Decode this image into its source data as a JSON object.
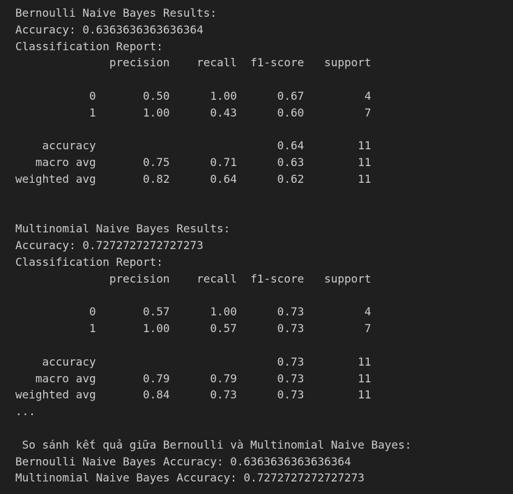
{
  "output_lines": [
    "Bernoulli Naive Bayes Results:",
    "Accuracy: 0.6363636363636364",
    "Classification Report:",
    "              precision    recall  f1-score   support",
    "",
    "           0       0.50      1.00      0.67         4",
    "           1       1.00      0.43      0.60         7",
    "",
    "    accuracy                           0.64        11",
    "   macro avg       0.75      0.71      0.63        11",
    "weighted avg       0.82      0.64      0.62        11",
    "",
    "",
    "Multinomial Naive Bayes Results:",
    "Accuracy: 0.7272727272727273",
    "Classification Report:",
    "              precision    recall  f1-score   support",
    "",
    "           0       0.57      1.00      0.73         4",
    "           1       1.00      0.57      0.73         7",
    "",
    "    accuracy                           0.73        11",
    "   macro avg       0.79      0.79      0.73        11",
    "weighted avg       0.84      0.73      0.73        11",
    "...",
    "",
    " So sánh kết quả giữa Bernoulli và Multinomial Naive Bayes:",
    "Bernoulli Naive Bayes Accuracy: 0.6363636363636364",
    "Multinomial Naive Bayes Accuracy: 0.7272727272727273"
  ]
}
